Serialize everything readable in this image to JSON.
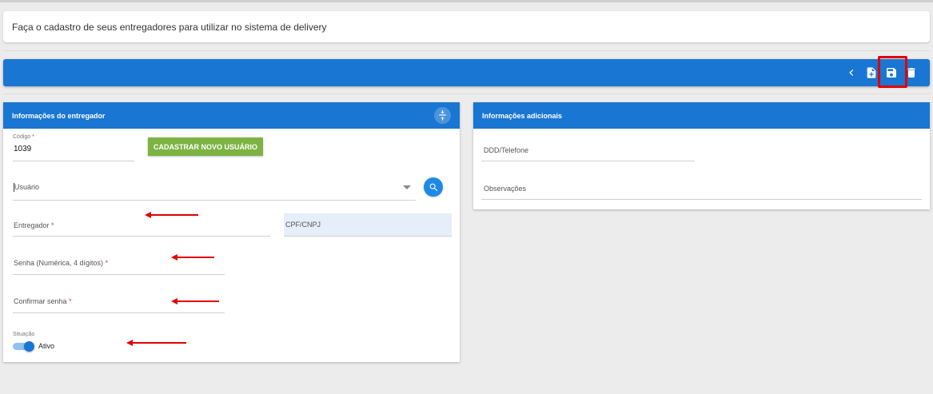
{
  "notice": {
    "text": "Faça o cadastro de seus entregadores para utilizar no sistema de delivery"
  },
  "toolbar": {
    "icons": [
      "chevron-left-icon",
      "new-file-icon",
      "save-icon",
      "delete-icon"
    ],
    "background": "#1976d2",
    "highlight_color": "#e00000"
  },
  "card_left": {
    "title": "Informações do entregador",
    "codigo": {
      "label": "Código",
      "required_mark": "*",
      "value": "1039"
    },
    "new_user_button": "CADASTRAR NOVO USUÁRIO",
    "usuario": {
      "placeholder": "Usuário"
    },
    "entregador": {
      "label": "Entregador",
      "required_mark": "*"
    },
    "cpf_cnpj": {
      "label": "CPF/CNPJ"
    },
    "senha": {
      "label": "Senha (Numérica, 4 dígitos)",
      "required_mark": "*"
    },
    "confirmar_senha": {
      "label": "Confirmar senha",
      "required_mark": "*"
    },
    "situacao": {
      "label": "Situação",
      "toggle_label": "Ativo",
      "checked": true
    }
  },
  "card_right": {
    "title": "Informações adicionais",
    "telefone": {
      "label": "DDD/Telefone"
    },
    "observacoes": {
      "label": "Observações"
    }
  },
  "accent_colors": {
    "primary": "#1976d2",
    "green": "#7cb342",
    "arrow": "#e00000"
  }
}
